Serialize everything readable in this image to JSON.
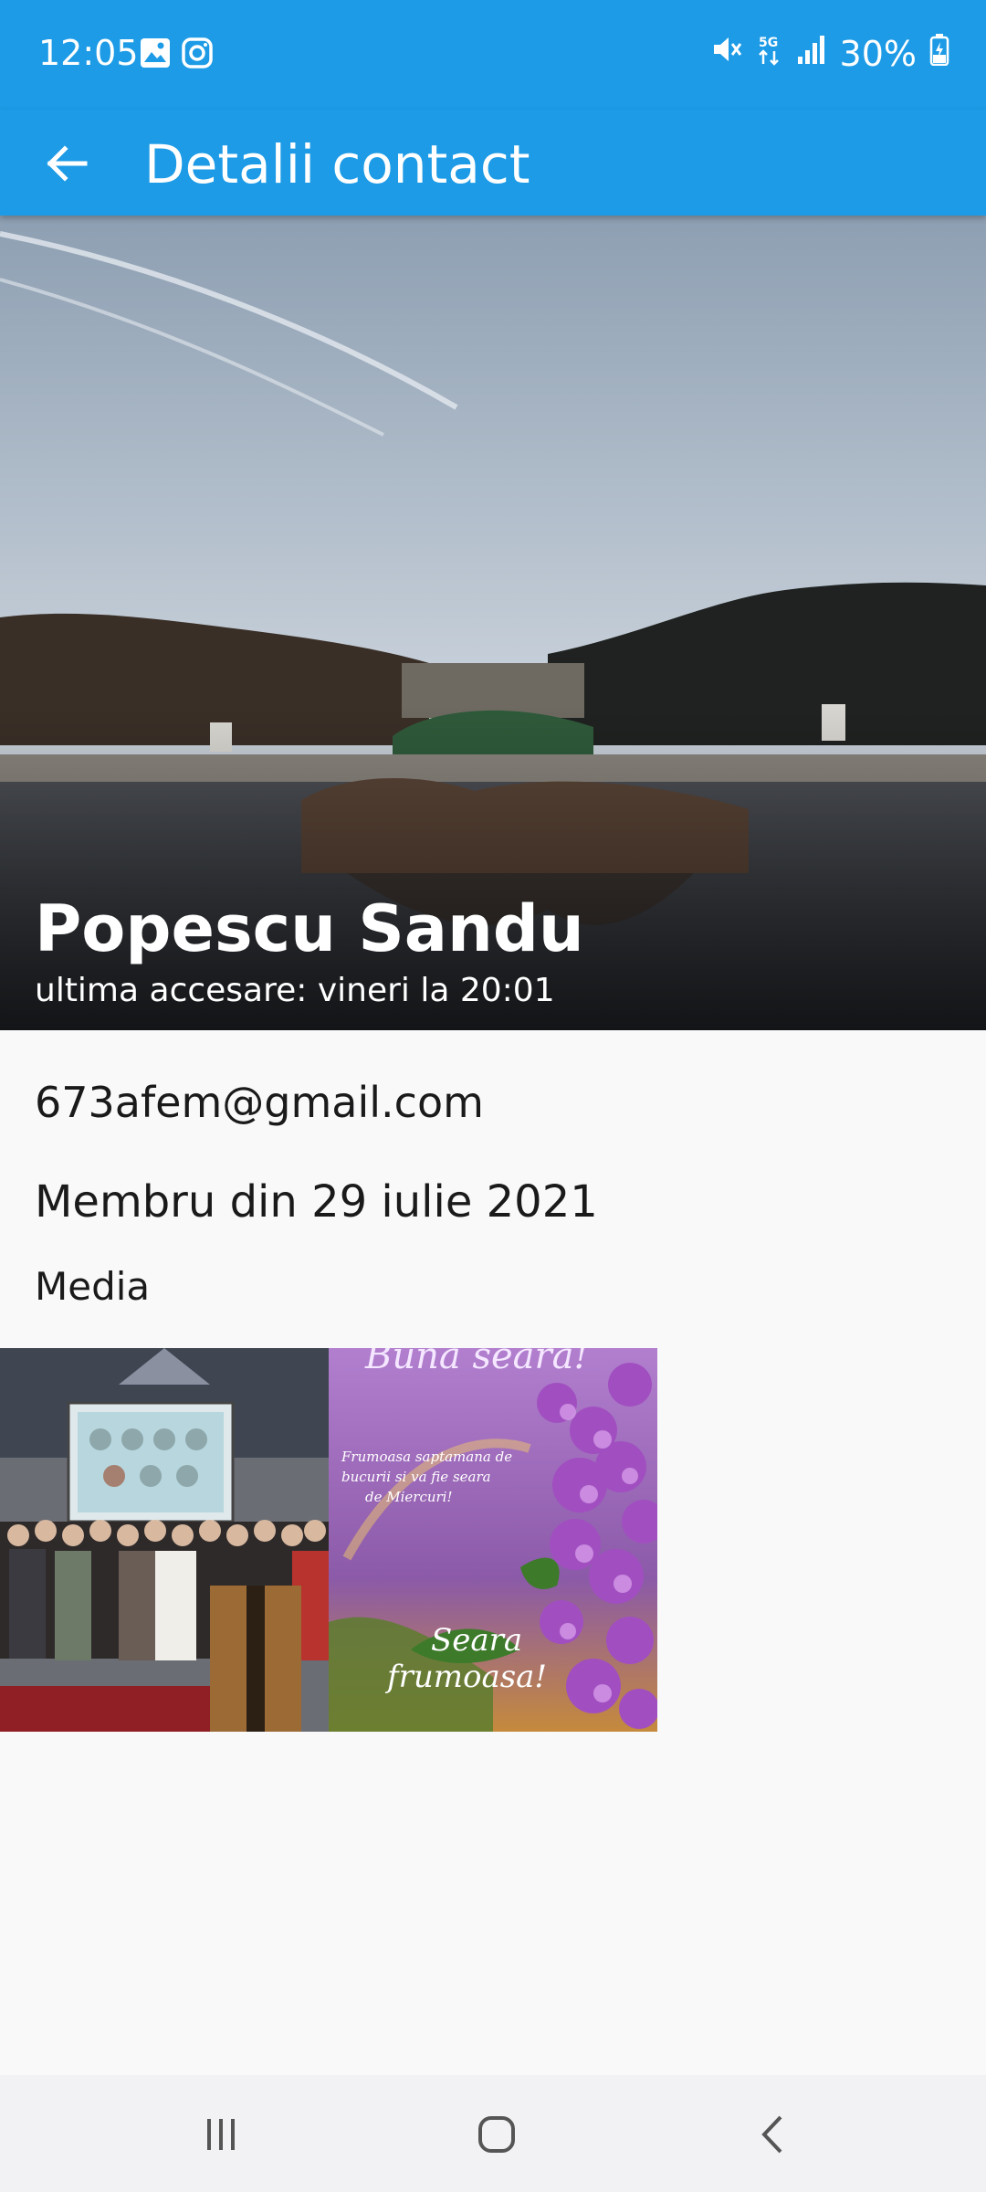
{
  "status_bar": {
    "time": "12:05",
    "battery": "30%",
    "icons": [
      "gallery-icon",
      "instagram-icon",
      "mute-icon",
      "5g-icon",
      "signal-icon",
      "battery-icon"
    ]
  },
  "app_bar": {
    "title": "Detalii contact",
    "back_icon": "arrow-left-icon",
    "color": "#1d9be6"
  },
  "profile": {
    "name": "Popescu Sandu",
    "last_seen": "ultima accesare: vineri la 20:01",
    "email": "673afem@gmail.com",
    "member_since": "Membru din 29 iulie 2021"
  },
  "media": {
    "label": "Media",
    "items": [
      {
        "name": "group-photo"
      },
      {
        "name": "lilac-greeting-card",
        "lines": [
          "Buna seara!",
          "Frumoasa saptamana de",
          "bucurii si va fie seara",
          "de Miercuri!",
          "Seara",
          "frumoasa!"
        ]
      }
    ]
  },
  "nav_bar": {
    "icons": [
      "recents-icon",
      "home-icon",
      "back-icon"
    ]
  }
}
